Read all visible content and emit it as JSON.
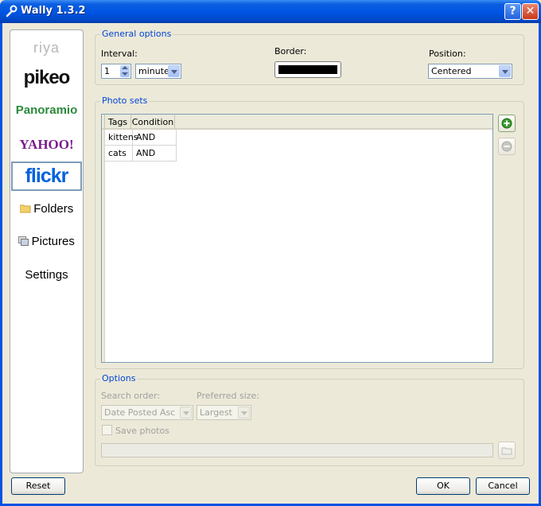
{
  "window": {
    "title": "Wally 1.3.2"
  },
  "sidebar": {
    "items": [
      {
        "label": "riya"
      },
      {
        "label": "pikeo"
      },
      {
        "label": "Panoramio"
      },
      {
        "label": "YAHOO!"
      },
      {
        "label": "flickr"
      },
      {
        "label": "Folders"
      },
      {
        "label": "Pictures"
      },
      {
        "label": "Settings"
      }
    ]
  },
  "general": {
    "title": "General options",
    "interval_label": "Interval:",
    "interval_value": "1",
    "interval_unit": "minutes",
    "border_label": "Border:",
    "border_color": "#000000",
    "position_label": "Position:",
    "position_value": "Centered"
  },
  "photosets": {
    "title": "Photo sets",
    "columns": [
      "Tags",
      "Condition"
    ],
    "rows": [
      {
        "tags": "kittens",
        "condition": "AND"
      },
      {
        "tags": "cats",
        "condition": "AND"
      }
    ]
  },
  "options": {
    "title": "Options",
    "search_order_label": "Search order:",
    "search_order_value": "Date Posted Asc",
    "preferred_size_label": "Preferred size:",
    "preferred_size_value": "Largest",
    "save_photos_label": "Save photos",
    "save_path": ""
  },
  "buttons": {
    "reset": "Reset",
    "ok": "OK",
    "cancel": "Cancel"
  },
  "colors": {
    "accent": "#0046d5",
    "titlebar": "#0054e3",
    "add_icon": "#3a9a2e"
  }
}
